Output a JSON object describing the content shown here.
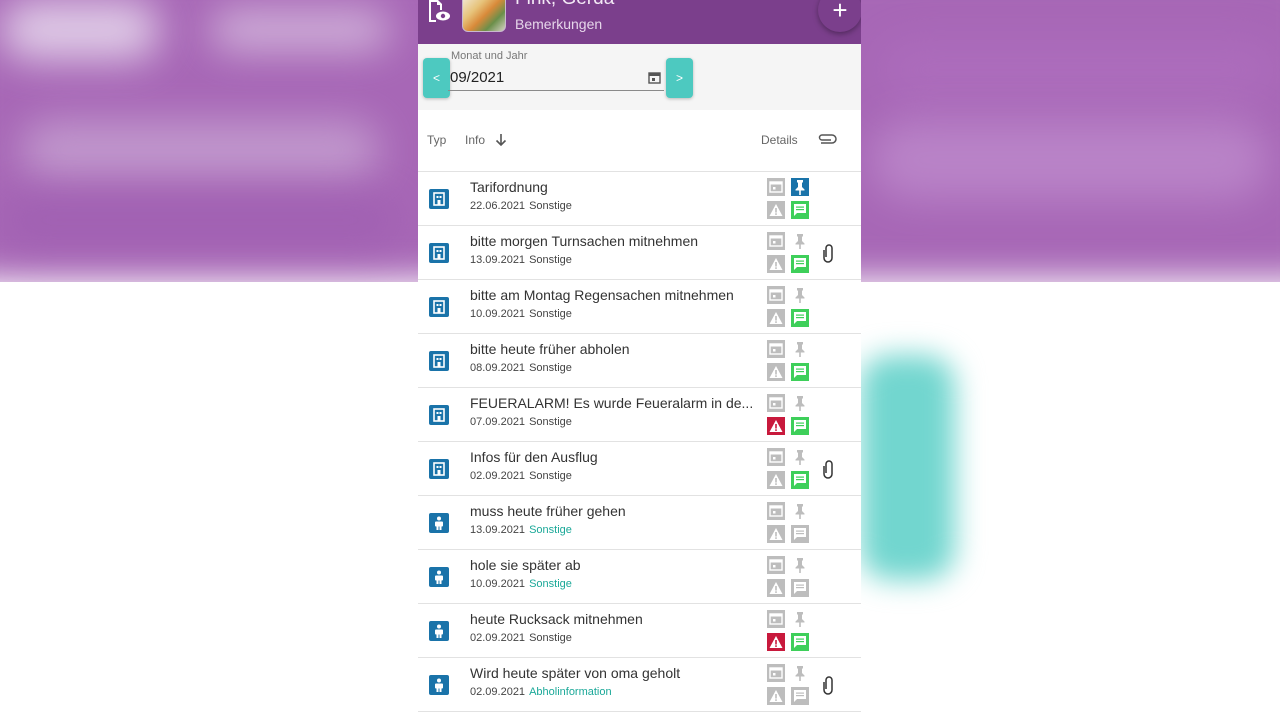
{
  "header": {
    "name": "Fink, Gerda",
    "subtitle": "Bemerkungen",
    "add_label": "+"
  },
  "filter": {
    "label": "Monat und Jahr",
    "value": "09/2021",
    "prev_label": "<",
    "next_label": ">"
  },
  "table": {
    "col_type": "Typ",
    "col_info": "Info",
    "col_details": "Details"
  },
  "colors": {
    "appbar": "#7b3f8c",
    "accent_teal": "#4dc9c0",
    "type_icon_blue": "#1a73a9",
    "note_green": "#3ecf5a",
    "alert_red": "#c8193c",
    "inactive_grey": "#bdbdbd"
  },
  "rows": [
    {
      "title": "Tarifordnung",
      "date": "22.06.2021",
      "category": "Sonstige",
      "category_style": "plain",
      "type": "building-icon",
      "pin": true,
      "alert": false,
      "note": true,
      "attachment": false
    },
    {
      "title": "bitte morgen Turnsachen mitnehmen",
      "date": "13.09.2021",
      "category": "Sonstige",
      "category_style": "plain",
      "type": "building-icon",
      "pin": false,
      "alert": false,
      "note": true,
      "attachment": true
    },
    {
      "title": "bitte am Montag Regensachen mitnehmen",
      "date": "10.09.2021",
      "category": "Sonstige",
      "category_style": "plain",
      "type": "building-icon",
      "pin": false,
      "alert": false,
      "note": true,
      "attachment": false
    },
    {
      "title": "bitte heute früher abholen",
      "date": "08.09.2021",
      "category": "Sonstige",
      "category_style": "plain",
      "type": "building-icon",
      "pin": false,
      "alert": false,
      "note": true,
      "attachment": false
    },
    {
      "title": "FEUERALARM! Es wurde Feueralarm in de...",
      "date": "07.09.2021",
      "category": "Sonstige",
      "category_style": "plain",
      "type": "building-icon",
      "pin": false,
      "alert": true,
      "note": true,
      "attachment": false
    },
    {
      "title": "Infos für den Ausflug",
      "date": "02.09.2021",
      "category": "Sonstige",
      "category_style": "plain",
      "type": "building-icon",
      "pin": false,
      "alert": false,
      "note": true,
      "attachment": true
    },
    {
      "title": "muss heute früher gehen",
      "date": "13.09.2021",
      "category": "Sonstige",
      "category_style": "teal",
      "type": "person-icon",
      "pin": false,
      "alert": false,
      "note": false,
      "attachment": false
    },
    {
      "title": "hole sie später ab",
      "date": "10.09.2021",
      "category": "Sonstige",
      "category_style": "teal",
      "type": "person-icon",
      "pin": false,
      "alert": false,
      "note": false,
      "attachment": false
    },
    {
      "title": "heute Rucksack mitnehmen",
      "date": "02.09.2021",
      "category": "Sonstige",
      "category_style": "plain",
      "type": "person-icon",
      "pin": false,
      "alert": true,
      "note": true,
      "attachment": false
    },
    {
      "title": "Wird heute später von oma geholt",
      "date": "02.09.2021",
      "category": "Abholinformation",
      "category_style": "teal",
      "type": "person-icon",
      "pin": false,
      "alert": false,
      "note": false,
      "attachment": true
    }
  ]
}
